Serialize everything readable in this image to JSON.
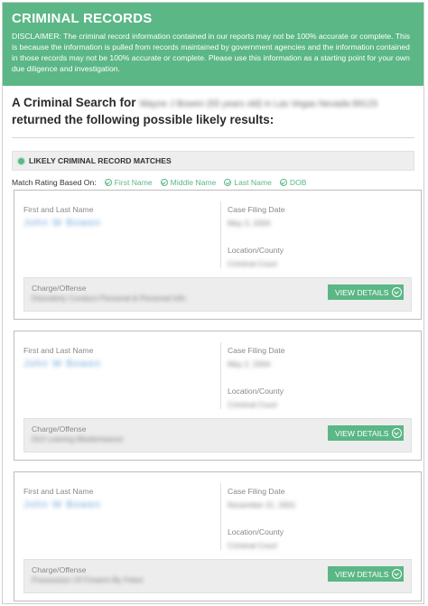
{
  "header": {
    "title": "CRIMINAL RECORDS",
    "disclaimer": "DISCLAIMER: The criminal record information contained in our reports may not be 100% accurate or complete. This is because the information is pulled from records maintained by government agencies and the information contained in those records may not be 100% accurate or complete. Please use this information as a starting point for your own due diligence and investigation."
  },
  "intro": {
    "prefix": "A Criminal Search for",
    "subject_blurred": "Wayne J Bowen (55 years old) in Las Vegas Nevada 89123",
    "suffix": "returned the following possible likely results:"
  },
  "matches": {
    "heading": "LIKELY CRIMINAL RECORD MATCHES",
    "rating_label": "Match Rating Based On:",
    "criteria": [
      "First Name",
      "Middle Name",
      "Last Name",
      "DOB"
    ]
  },
  "labels": {
    "name": "First and Last Name",
    "filing_date": "Case Filing Date",
    "location": "Location/County",
    "charge": "Charge/Offense",
    "details_button": "VIEW DETAILS"
  },
  "records": [
    {
      "name": "John W Bowen",
      "filing_date": "May 3, 2004",
      "location": "Criminal Court",
      "charge": "Disorderly Conduct Personal & Personal Info"
    },
    {
      "name": "John W Bowen",
      "filing_date": "May 2, 2004",
      "location": "Criminal Court",
      "charge": "DUI Leaving Misdemeanor"
    },
    {
      "name": "John W Bowen",
      "filing_date": "November 21, 2001",
      "location": "Criminal Court",
      "charge": "Possession Of Firearm By Felon"
    }
  ]
}
